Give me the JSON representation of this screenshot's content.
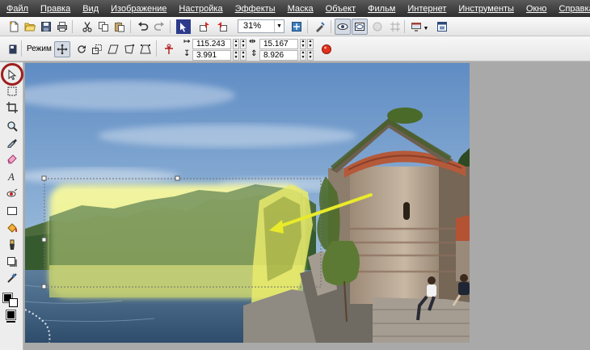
{
  "menu": [
    "Файл",
    "Правка",
    "Вид",
    "Изображение",
    "Настройка",
    "Эффекты",
    "Маска",
    "Объект",
    "Фильм",
    "Интернет",
    "Инструменты",
    "Окно",
    "Справка"
  ],
  "toolbar": {
    "zoom_value": "31%",
    "icons": [
      "new-document-icon",
      "open-icon",
      "save-icon",
      "print-icon",
      "cut-icon",
      "copy-icon",
      "paste-icon",
      "undo-icon",
      "redo-icon",
      "launch-icon",
      "import-icon",
      "export-icon",
      "zoom-dropdown",
      "fit-icon",
      "correct-icon",
      "view-mode-icon",
      "display-mode-icon",
      "mask-icon",
      "grid-icon",
      "options-icon",
      "window-icon"
    ]
  },
  "property_bar": {
    "mode_label": "Режим",
    "x_value": "115.243",
    "y_value": "3.991",
    "width_value": "15.167",
    "height_value": "8.926"
  },
  "tools": [
    "pick-tool",
    "mask-tool",
    "crop-tool",
    "zoom-tool",
    "eyedropper-tool",
    "eraser-tool",
    "text-tool",
    "red-eye-tool",
    "rectangle-tool",
    "fill-tool",
    "clone-tool",
    "shadow-tool",
    "effect-tool",
    "color-swatches"
  ],
  "colors": {
    "menubar": "#3c3c3c",
    "highlight_circle": "#9e1d1d",
    "arrow": "#e9ea2a",
    "selection_glow": "#f4f48a"
  }
}
